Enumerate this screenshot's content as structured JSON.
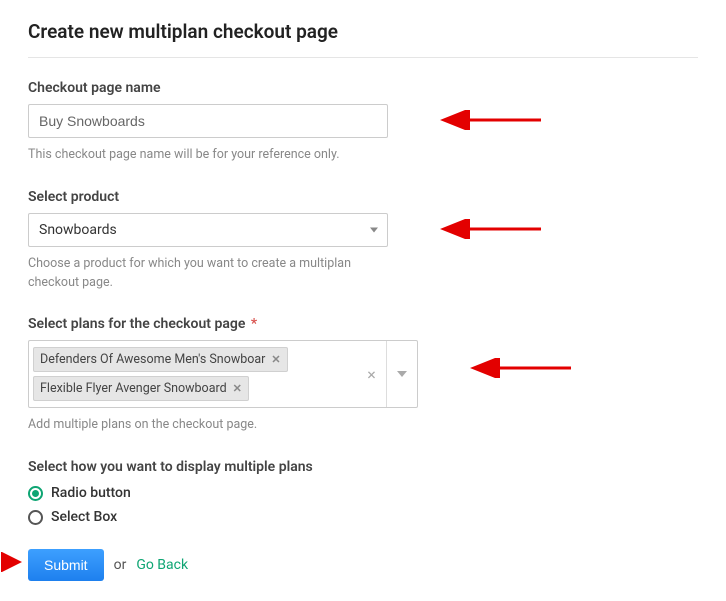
{
  "title": "Create new multiplan checkout page",
  "fields": {
    "name": {
      "label": "Checkout page name",
      "value": "Buy Snowboards",
      "help": "This checkout page name will be for your reference only."
    },
    "product": {
      "label": "Select product",
      "value": "Snowboards",
      "help": "Choose a product for which you want to create a multiplan checkout page."
    },
    "plans": {
      "label": "Select plans for the checkout page",
      "required": "*",
      "tags": [
        "Defenders Of Awesome Men's Snowboar",
        "Flexible Flyer Avenger Snowboard"
      ],
      "help": "Add multiple plans on the checkout page."
    },
    "display": {
      "label": "Select how you want to display multiple plans",
      "options": {
        "radio": "Radio button",
        "select": "Select Box"
      }
    }
  },
  "actions": {
    "submit": "Submit",
    "or": "or",
    "goback": "Go Back"
  }
}
